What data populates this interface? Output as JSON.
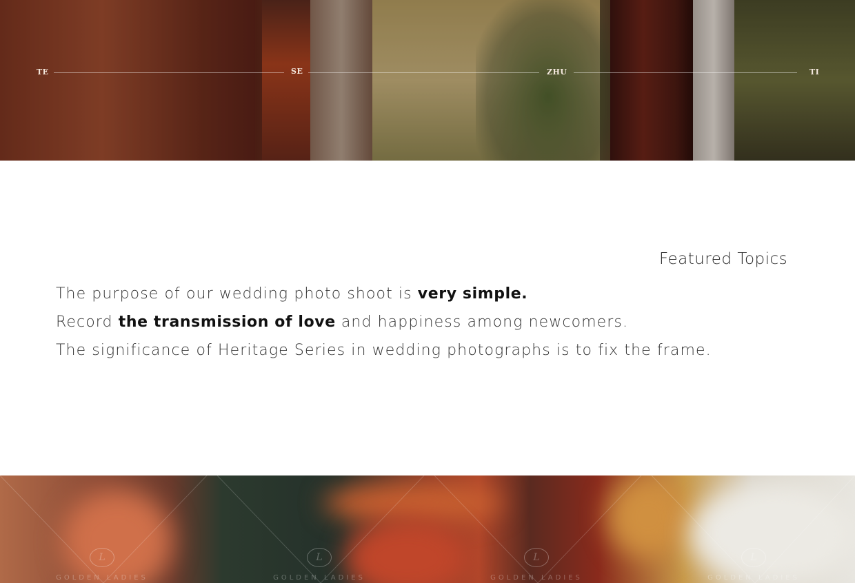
{
  "hero_top": {
    "letters": [
      "TE",
      "SE",
      "ZHU",
      "TI"
    ]
  },
  "section": {
    "heading": "Featured Topics",
    "line1_prefix": "The purpose of our wedding photo shoot is ",
    "line1_bold": "very simple.",
    "line2_prefix": "Record ",
    "line2_bold": "the transmission of love",
    "line2_suffix": " and happiness among newcomers.",
    "line3": "The significance of Heritage Series in wedding photographs is to fix the frame."
  },
  "hero_bottom": {
    "watermark_mark": "L",
    "watermark_text": "GOLDEN LADIES"
  }
}
